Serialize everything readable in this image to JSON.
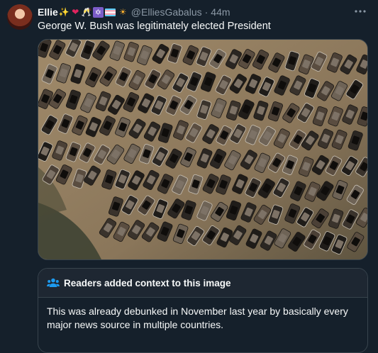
{
  "tweet": {
    "display_name": "Ellie",
    "name_emojis": [
      "✨",
      "❤",
      "🥂",
      "✡",
      "trans-flag",
      "☀"
    ],
    "handle": "@ElliesGabalus",
    "separator": "·",
    "time": "44m",
    "more_icon": "ellipsis-icon",
    "text": "George W. Bush was legitimately elected President"
  },
  "media": {
    "description_icon": "aerial-photo-burned-cars"
  },
  "community_note": {
    "icon": "people-icon",
    "heading": "Readers added context to this image",
    "body": "This was already debunked in November last year by basically every major news source in multiple countries."
  },
  "colors": {
    "background": "#15202b",
    "text": "#f7f9f9",
    "secondary": "#8b98a5",
    "border": "#38444d",
    "note_header_bg": "#1e2732",
    "accent_blue": "#1d9bf0"
  }
}
